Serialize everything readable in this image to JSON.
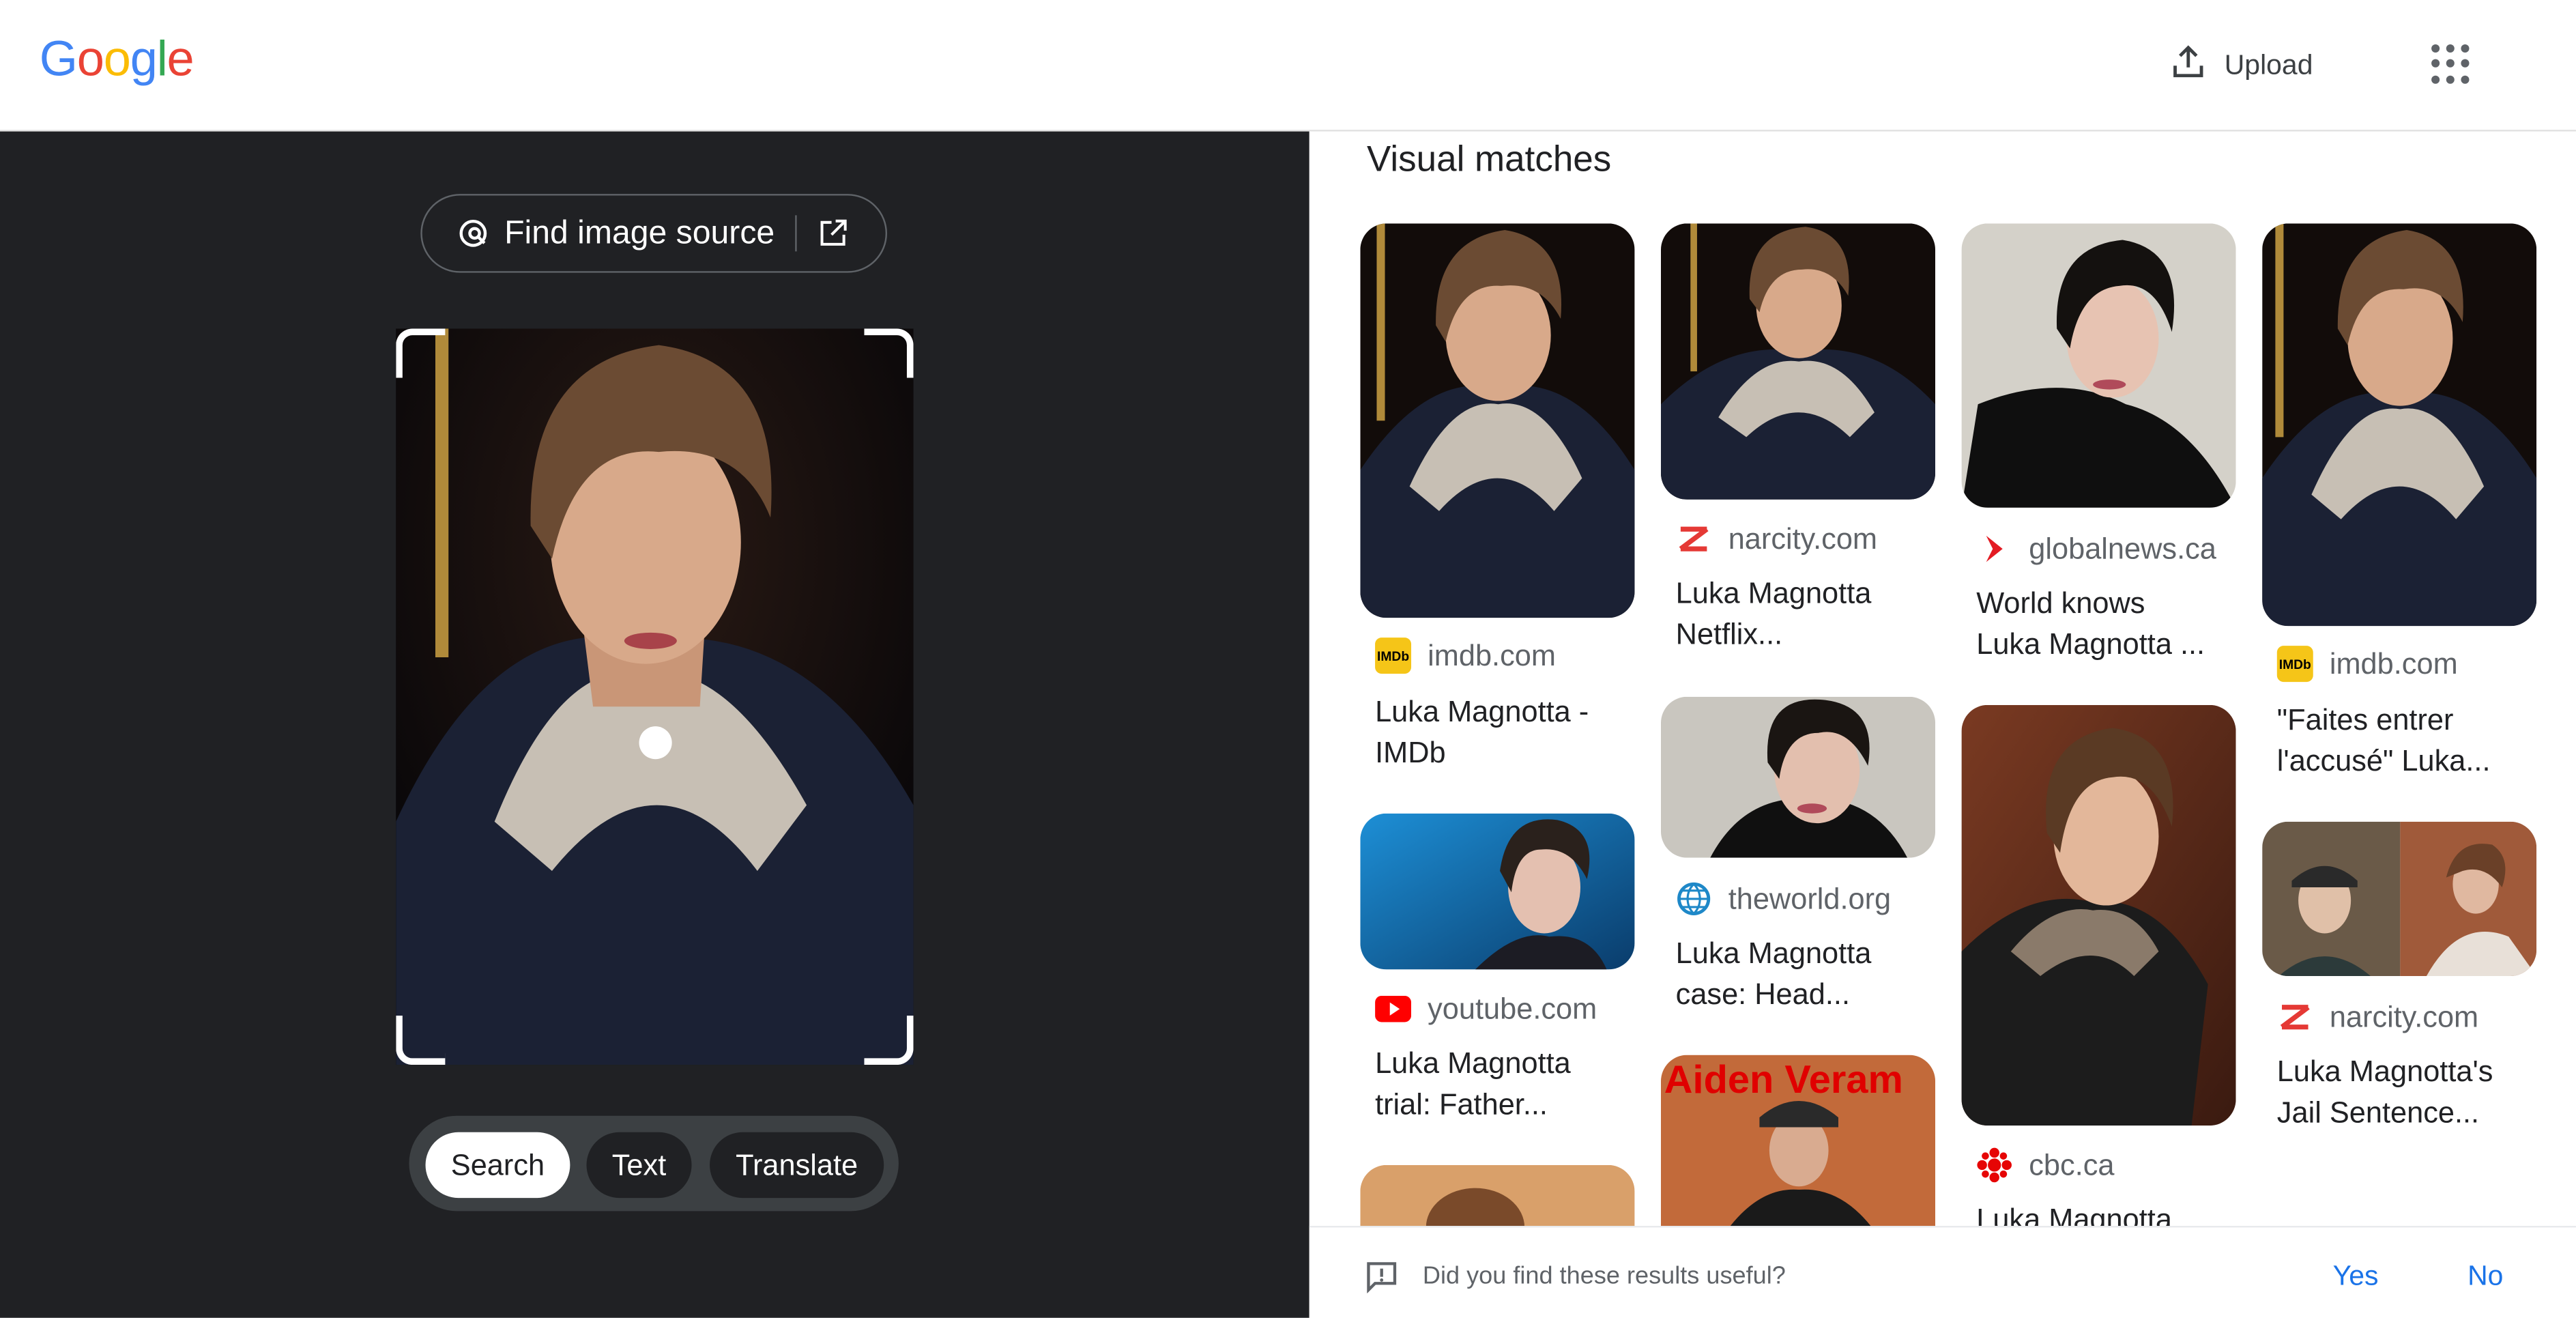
{
  "header": {
    "logo": [
      "G",
      "o",
      "o",
      "g",
      "l",
      "e"
    ],
    "logo_colors": [
      "#4285f4",
      "#ea4335",
      "#fbbc05",
      "#4285f4",
      "#34a853",
      "#ea4335"
    ],
    "upload_label": "Upload",
    "upload_icon": "upload-icon",
    "apps_icon": "apps-grid-icon"
  },
  "left": {
    "find_source_label": "Find image source",
    "find_source_icon": "lens-search-icon",
    "open_new_icon": "open-in-new-icon",
    "modes": [
      "Search",
      "Text",
      "Translate"
    ],
    "active_mode": "Search"
  },
  "results": {
    "title": "Visual matches",
    "cards": [
      {
        "site": "imdb.com",
        "title_lines": [
          "Luka Magnotta -",
          "IMDb"
        ],
        "favicon": "imdb-icon"
      },
      {
        "site": "narcity.com",
        "title_lines": [
          "Luka Magnotta",
          "Netflix..."
        ],
        "favicon": "narcity-icon"
      },
      {
        "site": "globalnews.ca",
        "title_lines": [
          "World knows",
          "Luka Magnotta ..."
        ],
        "favicon": "globalnews-icon"
      },
      {
        "site": "imdb.com",
        "title_lines": [
          "\"Faites entrer",
          "l'accusé\" Luka..."
        ],
        "favicon": "imdb-icon"
      },
      {
        "site": "youtube.com",
        "title_lines": [
          "Luka Magnotta",
          "trial: Father..."
        ],
        "favicon": "youtube-icon"
      },
      {
        "site": "theworld.org",
        "title_lines": [
          "Luka Magnotta",
          "case: Head..."
        ],
        "favicon": "globe-icon"
      },
      {
        "site": "cbc.ca",
        "title_lines": [
          "Luka Magnotta"
        ],
        "favicon": "cbc-icon"
      },
      {
        "site": "narcity.com",
        "title_lines": [
          "Luka Magnotta's",
          "Jail Sentence..."
        ],
        "favicon": "narcity-icon"
      }
    ],
    "thumb_overlay_text": "Aiden Veram"
  },
  "feedback": {
    "question": "Did you find these results useful?",
    "yes": "Yes",
    "no": "No",
    "icon": "feedback-icon"
  },
  "colors": {
    "left_bg": "#202124",
    "accent": "#1a73e8",
    "imdb": "#f5c518",
    "youtube": "#ff0000",
    "narcity": "#e53935",
    "cbc": "#e60505"
  }
}
